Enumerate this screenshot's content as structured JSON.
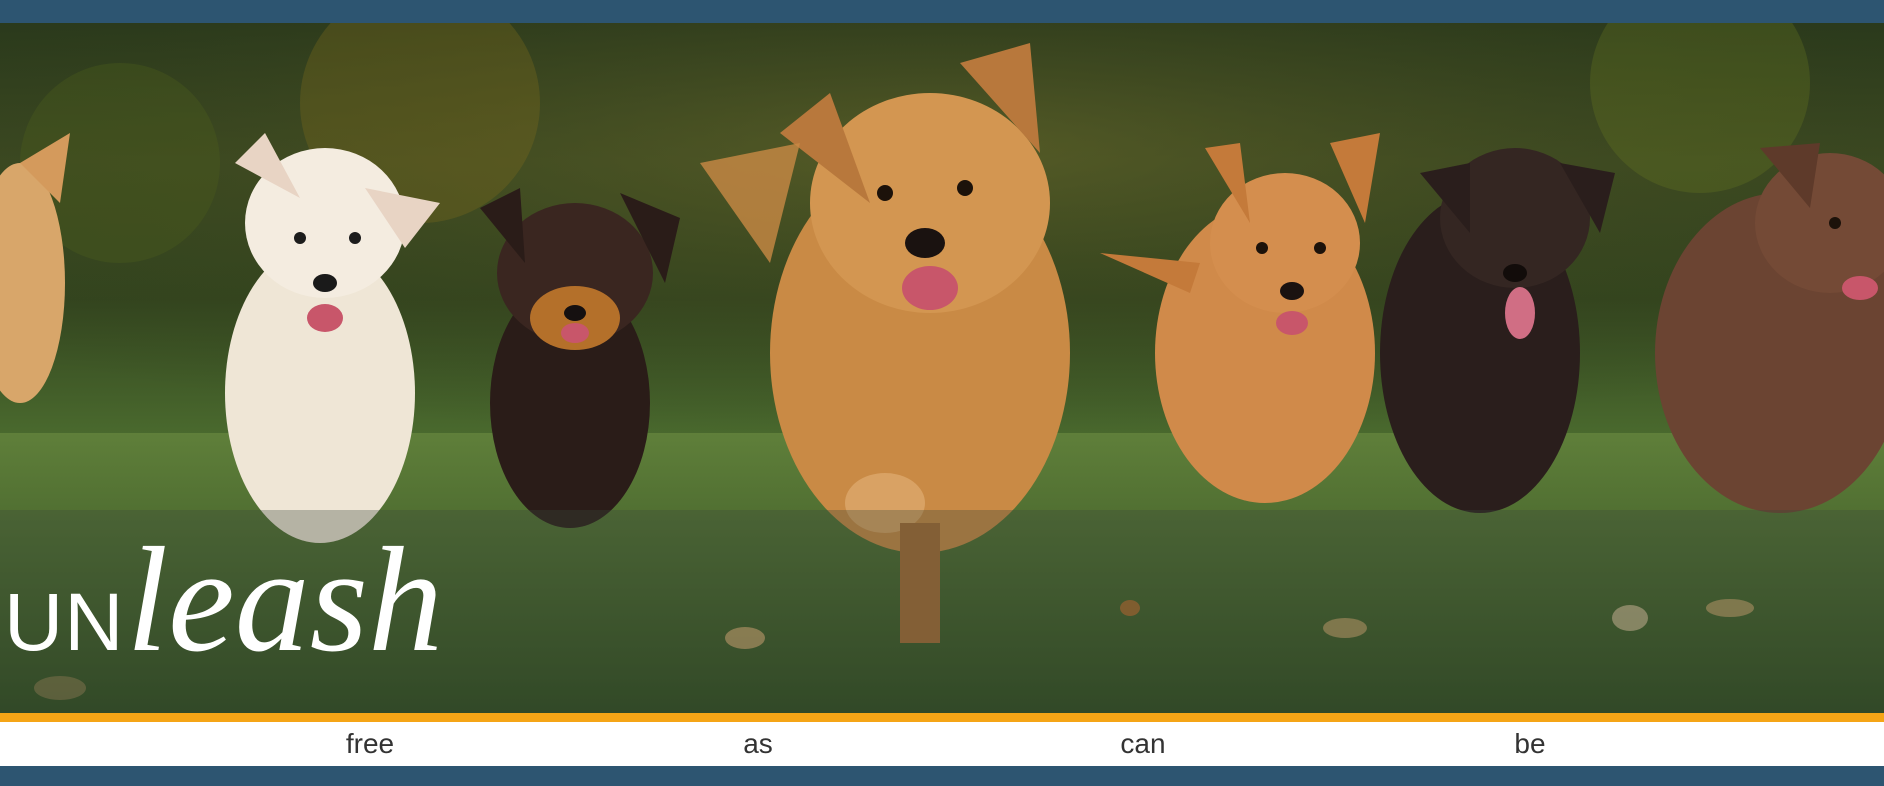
{
  "colors": {
    "bar": "#2d5571",
    "accent": "#f5a516",
    "nav_text": "#333333"
  },
  "hero": {
    "image_description_icon": "running-dogs-photo"
  },
  "banner": {
    "prefix": "UN",
    "word": "leash"
  },
  "nav": {
    "items": [
      "free",
      "as",
      "can",
      "be"
    ]
  }
}
